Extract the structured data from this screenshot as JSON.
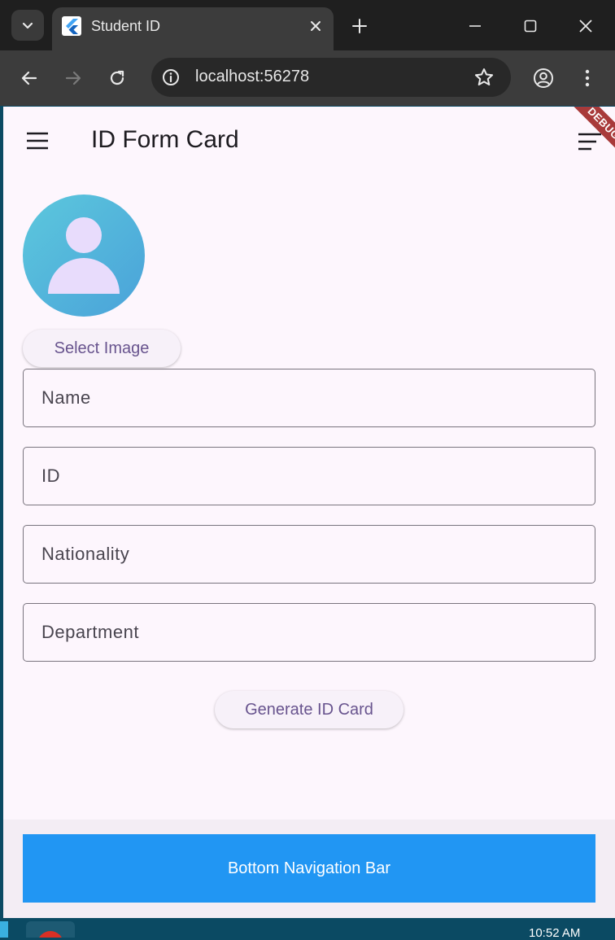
{
  "browser": {
    "tab_title": "Student ID",
    "url": "localhost:56278"
  },
  "app": {
    "title": "ID Form Card",
    "debug_banner": "DEBUG",
    "select_image_label": "Select Image",
    "fields": {
      "name_placeholder": "Name",
      "id_placeholder": "ID",
      "nationality_placeholder": "Nationality",
      "department_placeholder": "Department"
    },
    "generate_label": "Generate ID Card",
    "bottom_nav_label": "Bottom Navigation Bar"
  },
  "taskbar": {
    "time": "10:52 AM"
  },
  "colors": {
    "app_background": "#fdf6fd",
    "bottom_nav": "#2196f3",
    "button_text": "#68548e",
    "debug_ribbon": "#a83a3a"
  }
}
